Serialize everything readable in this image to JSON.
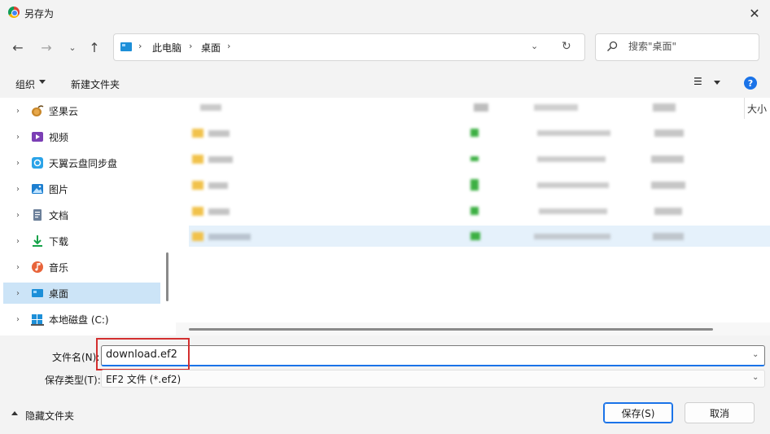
{
  "window": {
    "title": "另存为",
    "close_glyph": "✕"
  },
  "nav": {
    "back_glyph": "←",
    "forward_glyph": "→",
    "recent_glyph": "⌄",
    "up_glyph": "↑",
    "breadcrumb": [
      "此电脑",
      "桌面"
    ],
    "sep_glyph": "›",
    "dropdown_glyph": "⌄",
    "refresh_glyph": "↻",
    "search_placeholder": "搜索\"桌面\""
  },
  "toolbar": {
    "organize": "组织",
    "new_folder": "新建文件夹",
    "view_glyph": "☰",
    "help_glyph": "?"
  },
  "sidebar": {
    "items": [
      {
        "label": "坚果云",
        "icon": "nut-icon"
      },
      {
        "label": "视频",
        "icon": "video-icon"
      },
      {
        "label": "天翼云盘同步盘",
        "icon": "cloud-sync-icon"
      },
      {
        "label": "图片",
        "icon": "picture-icon"
      },
      {
        "label": "文档",
        "icon": "document-icon"
      },
      {
        "label": "下载",
        "icon": "download-icon"
      },
      {
        "label": "音乐",
        "icon": "music-icon"
      },
      {
        "label": "桌面",
        "icon": "desktop-icon",
        "selected": true
      },
      {
        "label": "本地磁盘 (C:)",
        "icon": "drive-icon"
      }
    ],
    "chevron_glyph": "›"
  },
  "filelist": {
    "size_column": "大小"
  },
  "form": {
    "filename_label": "文件名(N):",
    "filename_value": "download.ef2",
    "filetype_label": "保存类型(T):",
    "filetype_value": "EF2 文件 (*.ef2)",
    "dropdown_glyph": "⌄"
  },
  "footer": {
    "hide_folders": "隐藏文件夹",
    "save": "保存(S)",
    "cancel": "取消"
  },
  "colors": {
    "accent": "#1a73e8",
    "selection": "#cce4f7",
    "highlight_box": "#d32f2f"
  }
}
